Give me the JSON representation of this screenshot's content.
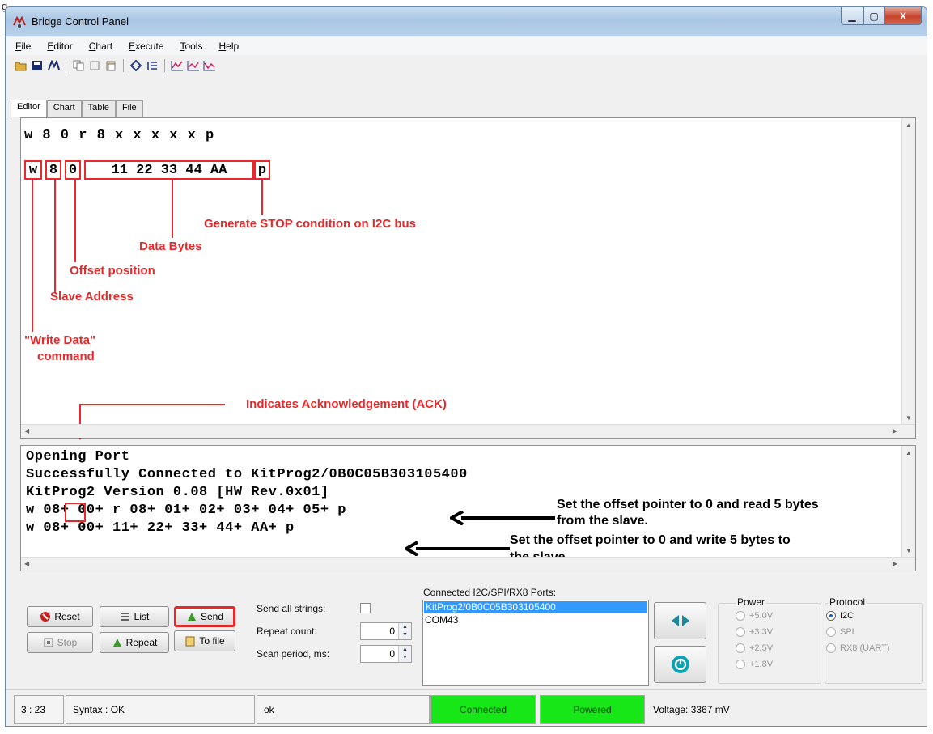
{
  "figure_label": "g",
  "window": {
    "title": "Bridge Control Panel",
    "min_glyph": "▁",
    "max_glyph": "▢",
    "close_glyph": "X"
  },
  "menu": [
    "File",
    "Editor",
    "Chart",
    "Execute",
    "Tools",
    "Help"
  ],
  "toolbar_icons": [
    "open-icon",
    "save-icon",
    "settings-icon",
    "copy-icon",
    "cut-icon",
    "paste-icon",
    "diamond-icon",
    "list-icon",
    "chart-icon",
    "chart-2-icon",
    "chart-3-icon"
  ],
  "tabs": [
    "Editor",
    "Chart",
    "Table",
    "File"
  ],
  "editor": {
    "line1": "w 8 0 r 8 x x x x x p",
    "segments": [
      "w",
      "8",
      "0",
      "11 22 33 44 AA",
      "p"
    ],
    "annotations": {
      "stop": "Generate STOP condition on I2C bus",
      "data_bytes": "Data Bytes",
      "offset": "Offset position",
      "slave_address": "Slave Address",
      "write_cmd_1": "\"Write Data\"",
      "write_cmd_2": "command",
      "ack": "Indicates Acknowledgement (ACK)"
    }
  },
  "console": {
    "lines": [
      "Opening Port",
      "Successfully Connected to KitProg2/0B0C05B303105400",
      "KitProg2 Version 0.08 [HW Rev.0x01]",
      "w 08+ 00+ r 08+ 01+ 02+ 03+ 04+ 05+ p",
      "w 08+ 00+ 11+ 22+ 33+ 44+ AA+ p"
    ],
    "annotations": {
      "read_1": "Set the offset pointer to 0 and read 5 bytes",
      "read_2": "from the slave.",
      "write_1": "Set the offset pointer to 0 and write 5 bytes to",
      "write_2": "the slave"
    }
  },
  "controls": {
    "reset": "Reset",
    "list": "List",
    "send": "Send",
    "stop": "Stop",
    "repeat": "Repeat",
    "to_file": "To file",
    "send_all_strings": "Send all strings:",
    "repeat_count_label": "Repeat count:",
    "repeat_count_value": "0",
    "scan_period_label": "Scan period, ms:",
    "scan_period_value": "0"
  },
  "ports": {
    "title": "Connected I2C/SPI/RX8 Ports:",
    "items": [
      "KitProg2/0B0C05B303105400",
      "COM43"
    ]
  },
  "power": {
    "title": "Power",
    "options": [
      "+5.0V",
      "+3.3V",
      "+2.5V",
      "+1.8V"
    ]
  },
  "protocol": {
    "title": "Protocol",
    "options": [
      "I2C",
      "SPI",
      "RX8 (UART)"
    ],
    "selected": "I2C"
  },
  "status": {
    "position": "3 : 23",
    "syntax": "Syntax : OK",
    "message": "ok",
    "connected": "Connected",
    "powered": "Powered",
    "voltage": "Voltage: 3367 mV"
  },
  "colors": {
    "annotation_red": "#e8282b",
    "status_green": "#17e617",
    "selection_blue": "#3399ff"
  }
}
